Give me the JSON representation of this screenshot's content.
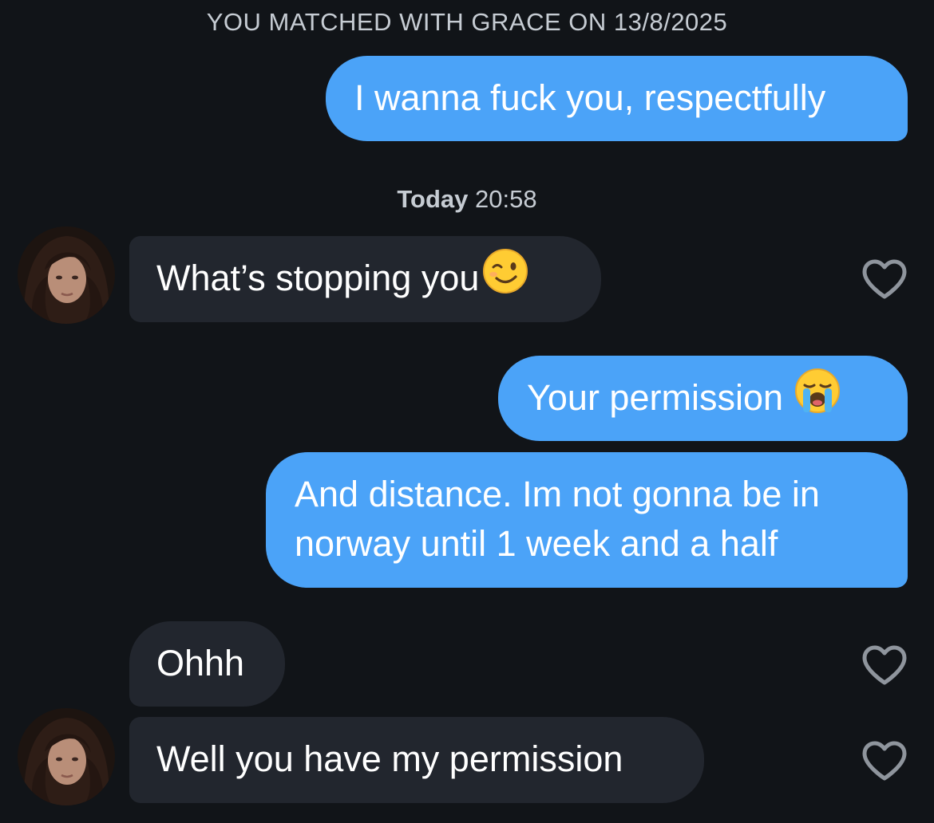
{
  "conversation": {
    "match_banner": "YOU MATCHED WITH GRACE ON 13/8/2025",
    "timestamp": {
      "day": "Today",
      "time": "20:58"
    },
    "messages": [
      {
        "from": "me",
        "text": "I wanna fuck you, respectfully"
      },
      {
        "from": "them",
        "text": "What’s stopping you",
        "emoji_icon": "winking-face-emoji",
        "liked": false
      },
      {
        "from": "me",
        "text": "Your permission",
        "emoji_icon": "loudly-crying-face-emoji"
      },
      {
        "from": "me",
        "lines": [
          "And distance. Im not gonna be in",
          "norway until 1 week and a half"
        ]
      },
      {
        "from": "them",
        "text": "Ohhh",
        "liked": false
      },
      {
        "from": "them",
        "text": "Well you have my permission",
        "liked": false
      }
    ]
  },
  "icons": {
    "heart": "heart-outline-icon",
    "avatar": "profile-photo"
  },
  "colors": {
    "background": "#111418",
    "outgoing_bubble": "#4ba3f8",
    "incoming_bubble": "#22262e",
    "meta_text": "#c6ccd3",
    "heart_outline": "#8f959d"
  }
}
